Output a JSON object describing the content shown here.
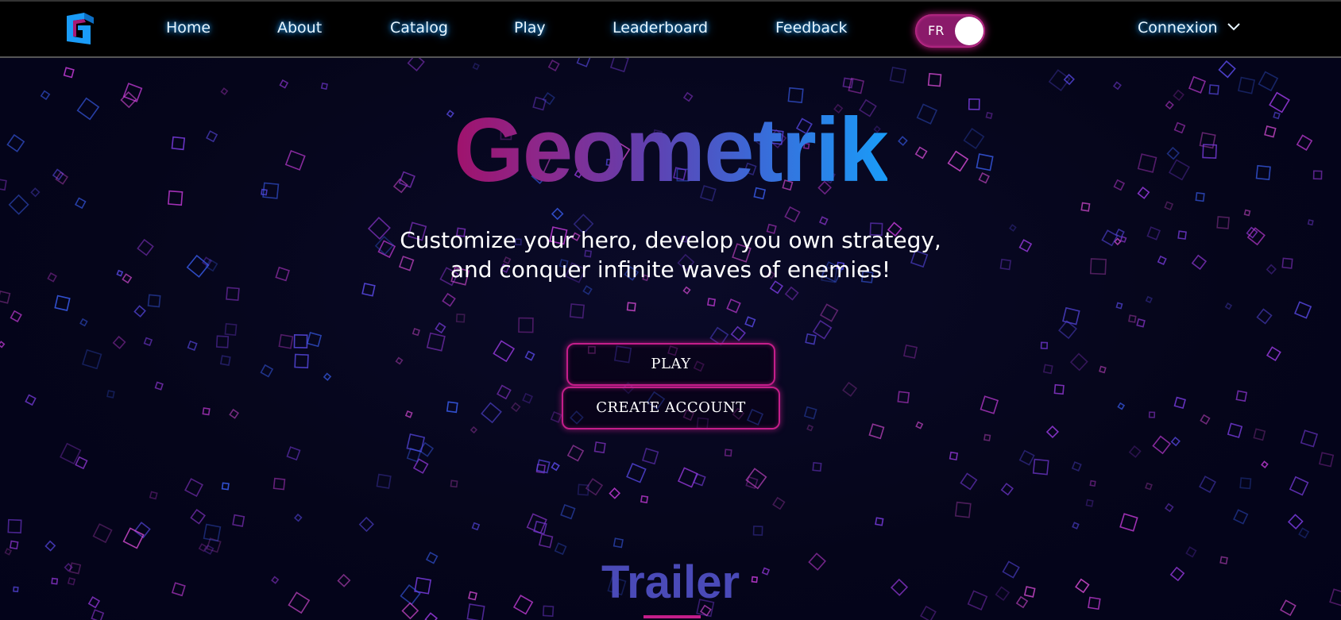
{
  "nav": {
    "items": [
      {
        "label": "Home"
      },
      {
        "label": "About"
      },
      {
        "label": "Catalog"
      },
      {
        "label": "Play"
      },
      {
        "label": "Leaderboard"
      },
      {
        "label": "Feedback"
      }
    ],
    "language_toggle": {
      "label": "FR"
    },
    "account": {
      "label": "Connexion",
      "icon": "chevron-down-icon"
    },
    "logo": {
      "icon": "geometrik-logo-icon"
    }
  },
  "hero": {
    "title": "Geometrik",
    "subtitle_line1": "Customize your hero, develop you own strategy,",
    "subtitle_line2": "and conquer infinite waves of enemies!",
    "play_button": "PLAY",
    "create_account_button": "CREATE ACCOUNT"
  },
  "trailer": {
    "heading": "Trailer"
  },
  "colors": {
    "background": "#04041a",
    "accent_magenta": "#c41e8a",
    "accent_blue": "#1a9cf8",
    "nav_glow": "#2aa8ff",
    "trailer": "#4a4ab8"
  }
}
